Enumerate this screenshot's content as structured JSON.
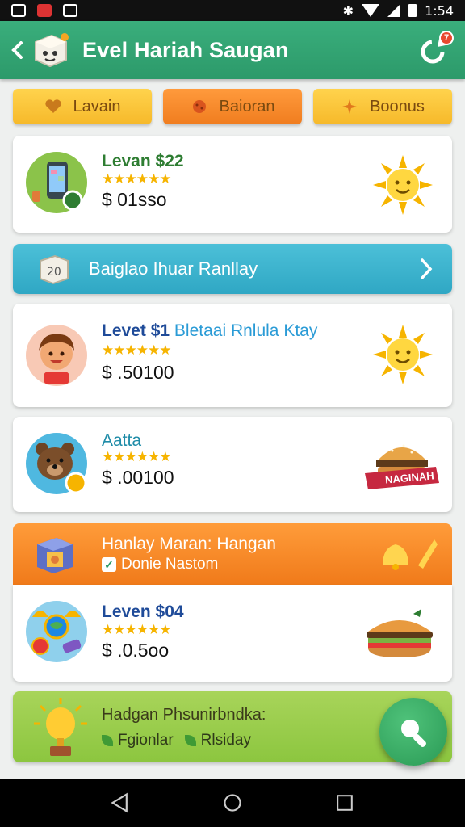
{
  "status_bar": {
    "time": "1:54"
  },
  "header": {
    "title": "Evel Hariah Saugan",
    "notification_count": "7"
  },
  "tabs": [
    {
      "label": "Lavain",
      "icon": "heart-icon",
      "color": "#f6b92a"
    },
    {
      "label": "Baioran",
      "icon": "cookie-icon",
      "color": "#f07d1f"
    },
    {
      "label": "Boonus",
      "icon": "sparkle-icon",
      "color": "#f6b92a"
    }
  ],
  "cards": [
    {
      "title": "Levan $22",
      "rating": "★★★★★★",
      "price": "$ 01sso",
      "avatar": "phone-icon",
      "art": "sun-icon"
    },
    {
      "title": "Levet $1",
      "title_extra": "Bletaai Rnlula Ktay",
      "rating": "★★★★★★",
      "price": "$ .50100",
      "avatar": "kid-avatar",
      "art": "sun-icon"
    },
    {
      "title": "Aatta",
      "rating": "★★★★★★",
      "price": "$ .00100",
      "avatar": "bear-avatar",
      "art": "burger-icon",
      "art_label": "NAGINAH"
    },
    {
      "title": "Leven $04",
      "rating": "★★★★★★",
      "price": "$ .0.5oo",
      "avatar": "globe-icon",
      "art": "burger-icon"
    }
  ],
  "banner": {
    "text": "Baiglao Ihuar Ranllay",
    "icon": "dice-icon"
  },
  "promo": {
    "title": "Hanlay Maran: Hangan",
    "subtitle": "Donie Nastom",
    "checked": true
  },
  "footer_card": {
    "title": "Hadgan Phsunirbndka:",
    "links": [
      "Fgionlar",
      "Rlsiday"
    ]
  },
  "colors": {
    "primary": "#2c9a6a",
    "accent": "#f07d1f",
    "banner": "#2fa7c4",
    "star": "#f6b400"
  }
}
